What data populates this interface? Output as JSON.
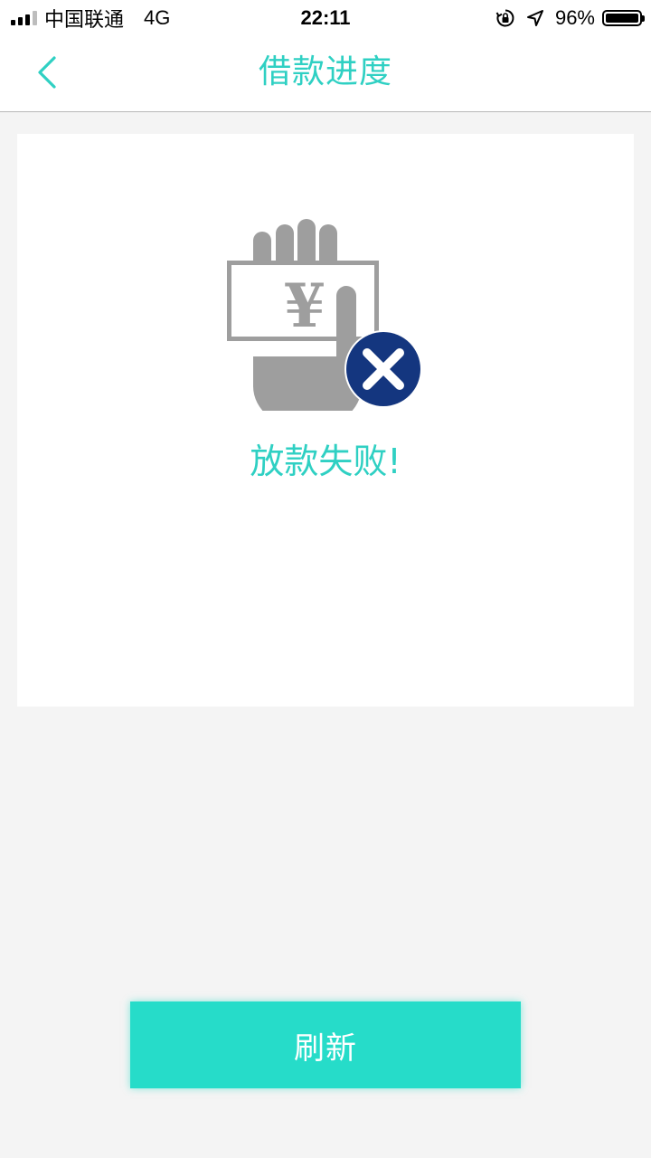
{
  "status_bar": {
    "carrier": "中国联通",
    "network": "4G",
    "time": "22:11",
    "battery": "96%",
    "icons": [
      "signal-icon",
      "rotation-lock-icon",
      "location-icon",
      "battery-icon"
    ]
  },
  "nav": {
    "back_icon": "chevron-left-icon",
    "title": "借款进度"
  },
  "card": {
    "illustration": "loan-failed-icon",
    "currency_symbol": "¥",
    "message": "放款失败!"
  },
  "actions": {
    "refresh_label": "刷新"
  },
  "colors": {
    "accent": "#2fd0c3",
    "button": "#26dcc9",
    "error_badge": "#14367f",
    "illustration_gray": "#9e9e9e",
    "background": "#f4f4f4"
  }
}
